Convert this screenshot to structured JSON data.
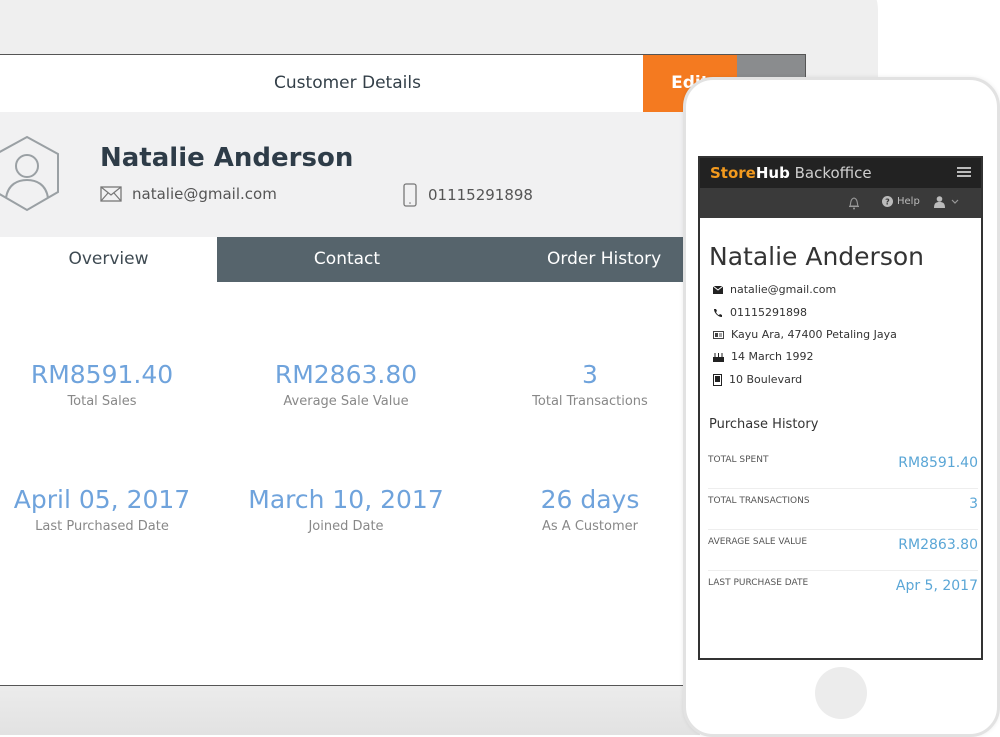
{
  "tablet": {
    "title": "Customer Details",
    "edit_label": "Edit",
    "customer": {
      "name": "Natalie Anderson",
      "email": "natalie@gmail.com",
      "phone": "01115291898"
    },
    "tabs": [
      {
        "label": "Overview",
        "active": true
      },
      {
        "label": "Contact",
        "active": false
      },
      {
        "label": "Order History",
        "active": false
      }
    ],
    "stats": [
      {
        "value": "RM8591.40",
        "label": "Total Sales"
      },
      {
        "value": "RM2863.80",
        "label": "Average Sale Value"
      },
      {
        "value": "3",
        "label": "Total Transactions"
      },
      {
        "value": "April 05, 2017",
        "label": "Last Purchased Date"
      },
      {
        "value": "March 10, 2017",
        "label": "Joined Date"
      },
      {
        "value": "26 days",
        "label": "As A Customer"
      }
    ]
  },
  "phone": {
    "brand": {
      "store": "Store",
      "hub": "Hub",
      "backoffice": " Backoffice"
    },
    "help_label": "Help",
    "customer": {
      "name": "Natalie Anderson",
      "email": "natalie@gmail.com",
      "phone": "01115291898",
      "address": "Kayu Ara, 47400 Petaling Jaya",
      "birthday": "14 March 1992",
      "building": "10 Boulevard"
    },
    "purchase_history": {
      "title": "Purchase History",
      "rows": [
        {
          "label": "TOTAL SPENT",
          "value": "RM8591.40"
        },
        {
          "label": "TOTAL TRANSACTIONS",
          "value": "3"
        },
        {
          "label": "AVERAGE SALE VALUE",
          "value": "RM2863.80"
        },
        {
          "label": "LAST PURCHASE DATE",
          "value": "Apr 5, 2017"
        }
      ]
    }
  },
  "colors": {
    "accent_orange": "#f47a20",
    "tab_slate": "#56646c",
    "stat_blue": "#6fa3dc",
    "phone_value_blue": "#5aa6d6",
    "brand_orange": "#f39a1e"
  }
}
